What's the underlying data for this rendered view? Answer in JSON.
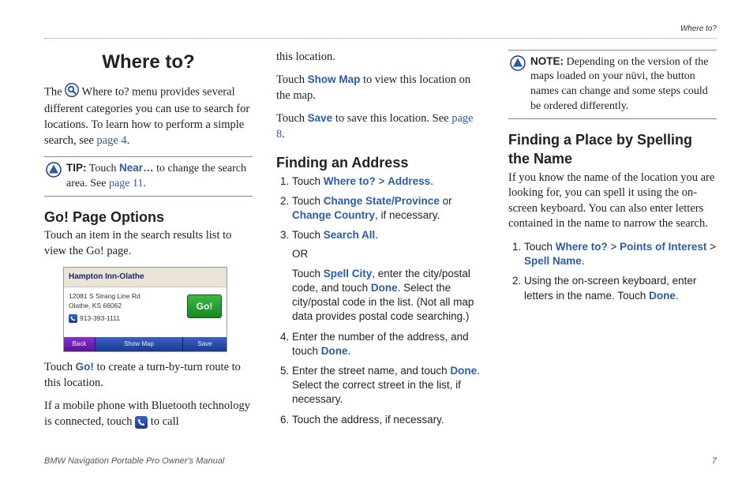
{
  "header_label": "Where to?",
  "col1": {
    "title": "Where to?",
    "intro_pre": "The ",
    "intro_post": " Where to? menu provides several different categories you can use to search for locations. To learn how to perform a simple search, see ",
    "intro_link": "page 4",
    "tip_label": "TIP:",
    "tip_text1": " Touch ",
    "tip_near": "Near…",
    "tip_text2": " to change the search area. See ",
    "tip_link": "page 11",
    "h2": "Go! Page Options",
    "p2": "Touch an item in the search results list to view the Go! page.",
    "device": {
      "title": "Hampton Inn-Olathe",
      "addr1": "12081 S Strang Line Rd",
      "addr2": "Olathe, KS 66062",
      "phone": "913-393-1111",
      "go": "Go!",
      "back": "Back",
      "show": "Show Map",
      "save": "Save"
    },
    "p3_pre": "Touch ",
    "p3_go": "Go!",
    "p3_post": " to create a turn-by-turn route to this location.",
    "p4_pre": "If a mobile phone with Bluetooth technology is connected, touch ",
    "p4_post": " to call"
  },
  "col2": {
    "p1": "this location.",
    "p2_pre": "Touch ",
    "p2_link": "Show Map",
    "p2_post": " to view this location on the map.",
    "p3_pre": "Touch ",
    "p3_link": "Save",
    "p3_post": " to save this location. See ",
    "p3_page": "page 8",
    "h2": "Finding an Address",
    "steps": [
      {
        "pre": "Touch ",
        "b1": "Where to?",
        "mid1": " > ",
        "b2": "Address",
        "post": "."
      },
      {
        "pre": "Touch ",
        "b1": "Change State/Province",
        "mid1": " or ",
        "b2": "Change Country",
        "post": ", if necessary."
      },
      {
        "pre": "Touch ",
        "b1": "Search All",
        "post": ".",
        "sub_or": "OR",
        "sub_pre": "Touch ",
        "sub_b1": "Spell City",
        "sub_mid1": ", enter the city/postal code, and touch ",
        "sub_b2": "Done",
        "sub_post": ". Select the city/postal code in the list. (Not all map data provides postal code searching.)"
      },
      {
        "pre": "Enter the number of the address, and touch ",
        "b1": "Done",
        "post": "."
      },
      {
        "pre": "Enter the street name, and touch ",
        "b1": "Done",
        "post": ". Select the correct street in the list, if necessary."
      },
      {
        "pre": "Touch the address, if necessary.",
        "b1": "",
        "post": ""
      }
    ]
  },
  "col3": {
    "note_label": "NOTE:",
    "note_text": " Depending on the version of the maps loaded on your nüvi, the button names can change and some steps could be ordered differently.",
    "h2": "Finding a Place by Spelling the Name",
    "p1": "If you know the name of the location you are looking for, you can spell it using the on-screen keyboard. You can also enter letters contained in the name to narrow the search.",
    "steps": [
      {
        "pre": "Touch ",
        "b1": "Where to?",
        "mid1": " > ",
        "b2": "Points of Interest",
        "mid2": " > ",
        "b3": "Spell Name",
        "post": "."
      },
      {
        "pre": "Using the on-screen keyboard, enter letters in the name. Touch ",
        "b1": "Done",
        "post": "."
      }
    ]
  },
  "footer": {
    "left": "BMW Navigation Portable Pro Owner's Manual",
    "right": "7"
  }
}
